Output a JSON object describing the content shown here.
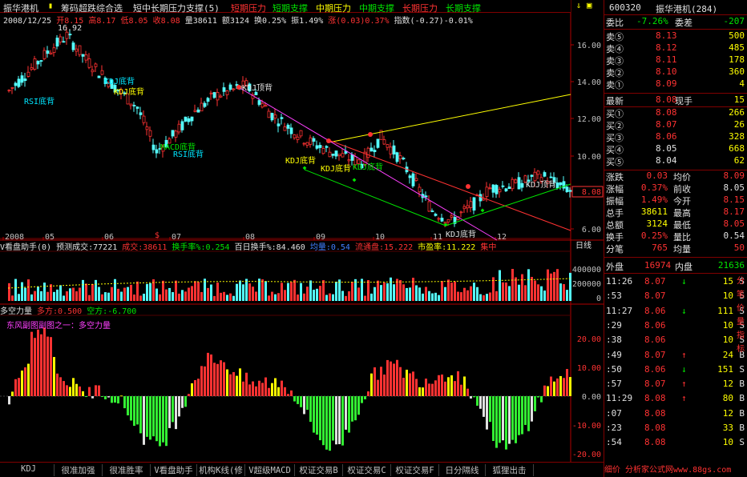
{
  "top": {
    "title": "振华港机",
    "items": [
      "筹码超跌综合选",
      "短中长期压力支撑(5)",
      "短期压力",
      "短期支撑",
      "中期压力",
      "中期支撑",
      "长期压力",
      "长期支撑"
    ]
  },
  "info1": {
    "date": "2008/12/25",
    "open": "开8.15",
    "high": "高8.17",
    "low": "低8.05",
    "close": "收8.08",
    "vol": "量38611",
    "amt": "额3124",
    "turn": "换0.25%",
    "amp": "振1.49%",
    "chg": "涨(0.03)0.37%",
    "idx": "指数(-0.27)-0.01%"
  },
  "info2": {
    "peak": "16.92"
  },
  "main_annotations": [
    "RSI底背",
    "KDJ底背",
    "KDJ底背",
    "MACD底背",
    "RSI底背",
    "KDJ顶背",
    "KDJ底背",
    "KDJ底背",
    "KDJ底背",
    "KDJ底背",
    "KDJ顶背"
  ],
  "y_ticks": [
    "16.00",
    "14.00",
    "12.00",
    "10.00",
    "8.00",
    "6.00"
  ],
  "price_marker": "8.08",
  "x_ticks": [
    "2008",
    "05",
    "06",
    "07",
    "08",
    "09",
    "10",
    "11",
    "12"
  ],
  "period_label": "日线",
  "vol_bar": {
    "title": "V看盘助手(0)",
    "pred": "预测成交:77221",
    "deal": "成交:38611",
    "turnrate": "换手率%:0.254",
    "hundred": "百日换手%:84.460",
    "avg": "均量:0.54",
    "float": "流通盘:15.222",
    "pe": "市盈率:11.222",
    "conc": "集中"
  },
  "vol_ticks": [
    "400000",
    "200000",
    "0"
  ],
  "ind": {
    "title": "多空力量",
    "long": "多方:0.500",
    "short": "空方:-6.700",
    "sub": "东风副图副图之一：多空力量"
  },
  "ind_ticks": [
    "20.00",
    "10.00",
    "0.00",
    "-10.00",
    "-20.00"
  ],
  "right": {
    "code": "600320",
    "name": "振华港机(284)",
    "wb_label": "委比",
    "wb_val": "-7.26%",
    "wc_label": "委差",
    "wc_val": "-207",
    "sells": [
      {
        "l": "卖⑤",
        "p": "8.13",
        "v": "500"
      },
      {
        "l": "卖④",
        "p": "8.12",
        "v": "485"
      },
      {
        "l": "卖③",
        "p": "8.11",
        "v": "178"
      },
      {
        "l": "卖②",
        "p": "8.10",
        "v": "360"
      },
      {
        "l": "卖①",
        "p": "8.09",
        "v": "4"
      }
    ],
    "last": {
      "l": "最新",
      "p": "8.08",
      "l2": "现手",
      "v": "15"
    },
    "buys": [
      {
        "l": "买①",
        "p": "8.08",
        "v": "266"
      },
      {
        "l": "买②",
        "p": "8.07",
        "v": "26"
      },
      {
        "l": "买③",
        "p": "8.06",
        "v": "328"
      },
      {
        "l": "买④",
        "p": "8.05",
        "v": "668"
      },
      {
        "l": "买⑤",
        "p": "8.04",
        "v": "62"
      }
    ],
    "stats": [
      {
        "a": "涨跌",
        "av": "0.03",
        "b": "均价",
        "bv": "8.09"
      },
      {
        "a": "涨幅",
        "av": "0.37%",
        "b": "前收",
        "bv": "8.05"
      },
      {
        "a": "振幅",
        "av": "1.49%",
        "b": "今开",
        "bv": "8.15"
      },
      {
        "a": "总手",
        "av": "38611",
        "b": "最高",
        "bv": "8.17"
      },
      {
        "a": "总额",
        "av": "3124",
        "b": "最低",
        "bv": "8.05"
      },
      {
        "a": "换手",
        "av": "0.25%",
        "b": "量比",
        "bv": "0.54"
      },
      {
        "a": "分笔",
        "av": "765",
        "b": "均量",
        "bv": "50"
      }
    ],
    "outer": {
      "l": "外盘",
      "v": "16974",
      "l2": "内盘",
      "v2": "21636"
    },
    "ticks": [
      {
        "t": "11:26",
        "p": "8.07",
        "d": "↓",
        "v": "15",
        "s": "S"
      },
      {
        "t": ":53",
        "p": "8.07",
        "d": "",
        "v": "10",
        "s": "S"
      },
      {
        "t": "11:27",
        "p": "8.06",
        "d": "↓",
        "v": "111",
        "s": "S"
      },
      {
        "t": ":29",
        "p": "8.06",
        "d": "",
        "v": "10",
        "s": "S"
      },
      {
        "t": ":38",
        "p": "8.06",
        "d": "",
        "v": "10",
        "s": "S"
      },
      {
        "t": ":49",
        "p": "8.07",
        "d": "↑",
        "v": "24",
        "s": "B"
      },
      {
        "t": ":50",
        "p": "8.06",
        "d": "↓",
        "v": "151",
        "s": "S"
      },
      {
        "t": ":57",
        "p": "8.07",
        "d": "↑",
        "v": "12",
        "s": "B"
      },
      {
        "t": "11:29",
        "p": "8.08",
        "d": "↑",
        "v": "80",
        "s": "B"
      },
      {
        "t": ":07",
        "p": "8.08",
        "d": "",
        "v": "12",
        "s": "B"
      },
      {
        "t": ":23",
        "p": "8.08",
        "d": "",
        "v": "33",
        "s": "B"
      },
      {
        "t": ":54",
        "p": "8.08",
        "d": "",
        "v": "10",
        "s": "S"
      }
    ],
    "side": [
      "分",
      "笔",
      "价",
      "量",
      "指",
      "标"
    ],
    "foot": "细价 分析家公式网www.88gs.com"
  },
  "tabs": [
    "KDJ",
    "很准加强",
    "很准胜率",
    "V看盘助手",
    "机构K线(修",
    "V超级MACD",
    "权证交易B",
    "权证交易C",
    "权证交易F",
    "日分隔线",
    "狐狸出击"
  ]
}
